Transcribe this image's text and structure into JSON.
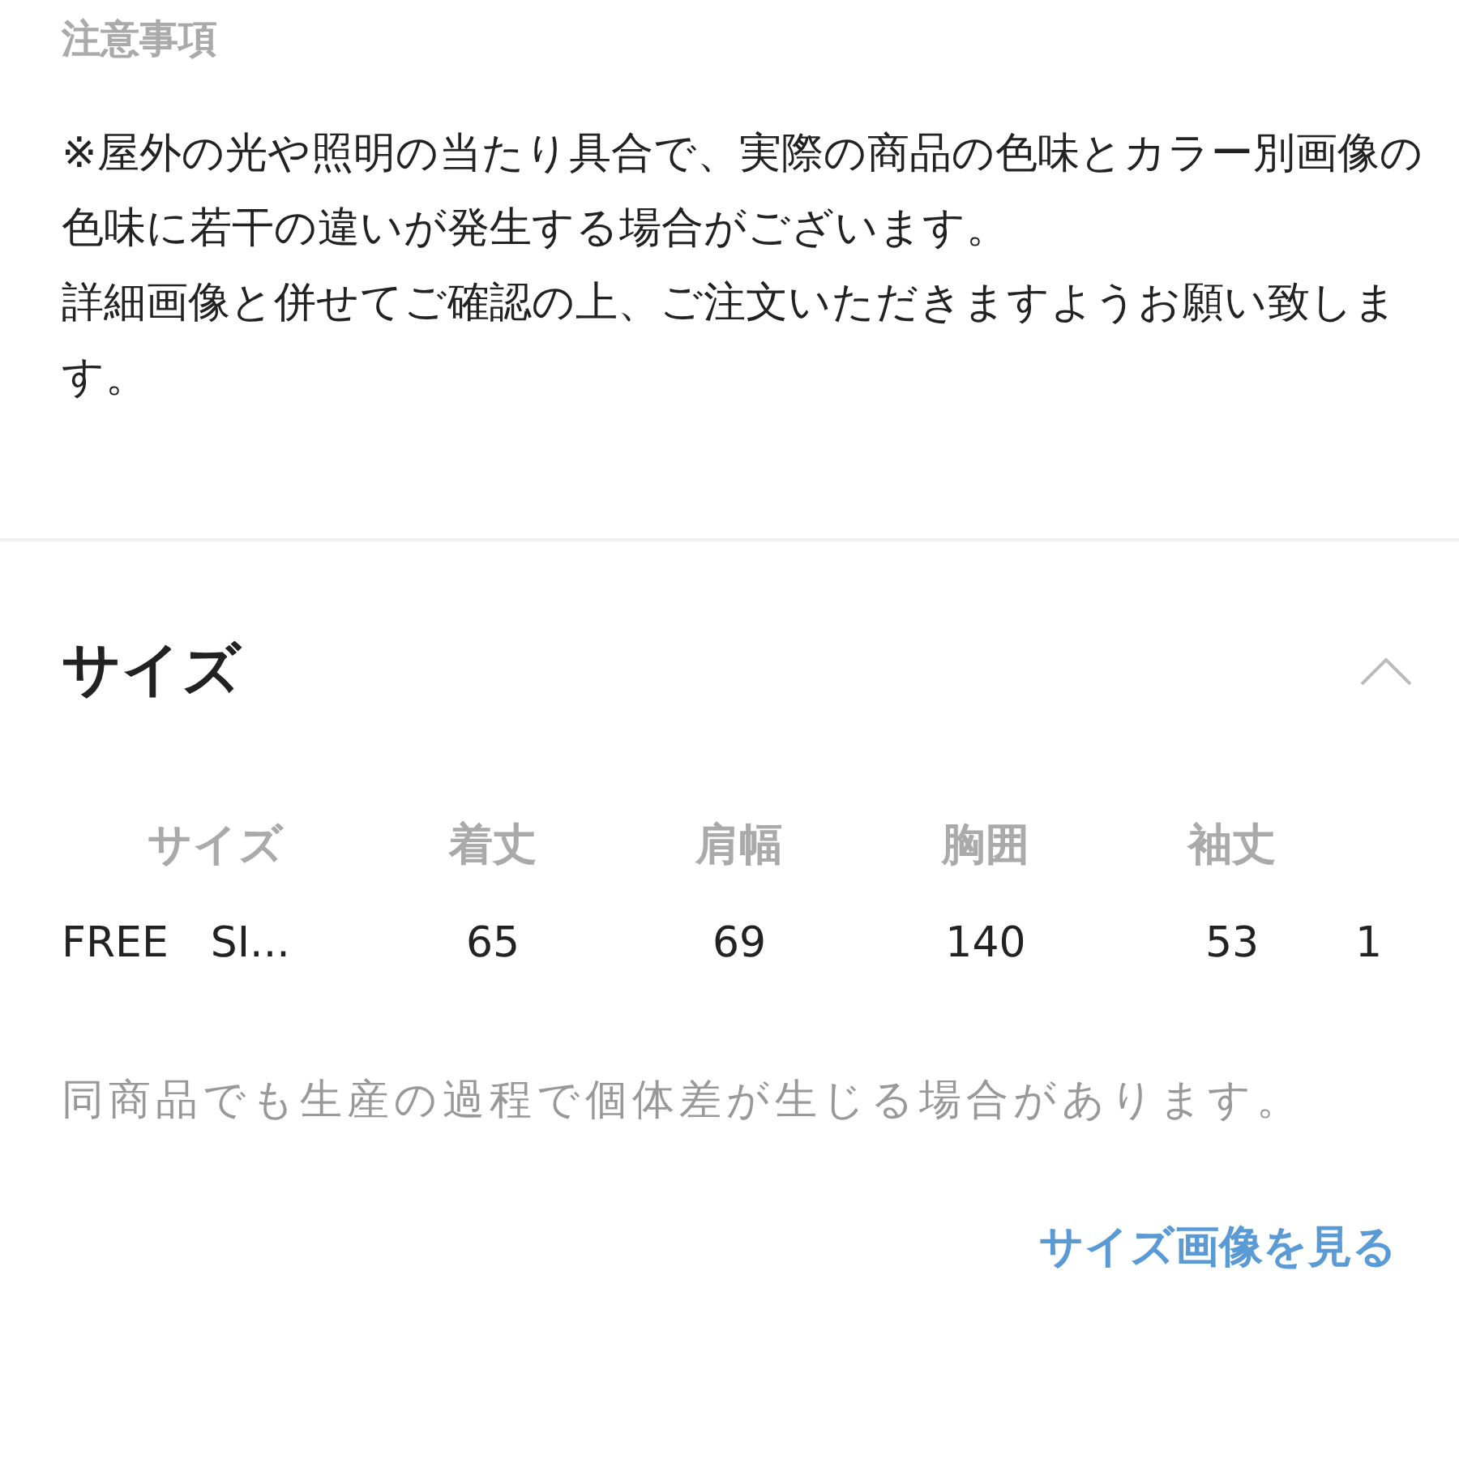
{
  "notes": {
    "title": "注意事項",
    "paragraphs": [
      "※屋外の光や照明の当たり具合で、実際の商品の色味とカラー別画像の色味に若干の違いが発生する場合がございます。",
      "詳細画像と併せてご確認の上、ご注文いただきますようお願い致します。"
    ]
  },
  "size_section": {
    "title": "サイズ",
    "expanded": true,
    "table": {
      "columns": [
        "サイズ",
        "着丈",
        "肩幅",
        "胸囲",
        "袖丈"
      ],
      "rows": [
        {
          "cells": [
            "FREE　SI...",
            "65",
            "69",
            "140",
            "53",
            "1"
          ]
        }
      ]
    },
    "footnote": "同商品でも生産の過程で個体差が生じる場合があります。",
    "link": "サイズ画像を見る"
  }
}
